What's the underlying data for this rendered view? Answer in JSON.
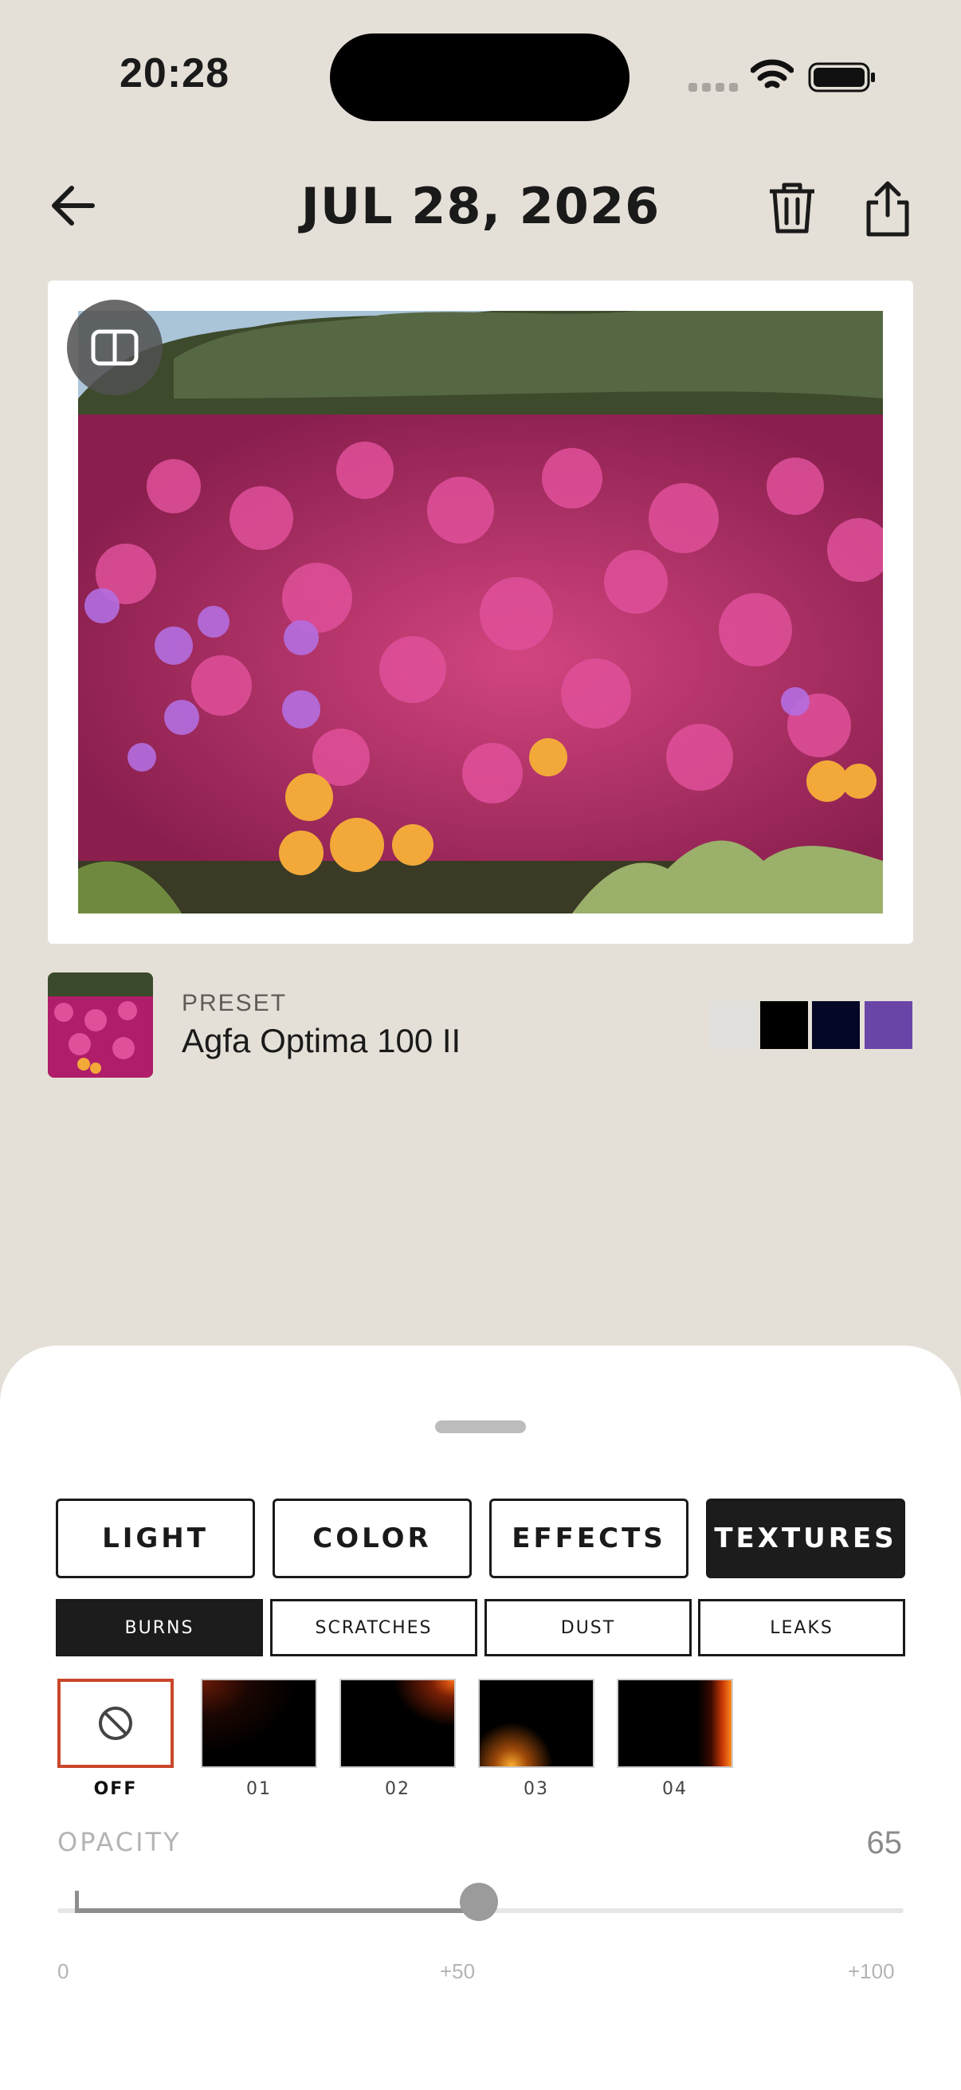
{
  "status_bar": {
    "time": "20:28"
  },
  "header": {
    "title": "JUL 28, 2026"
  },
  "preset": {
    "label": "PRESET",
    "name": "Agfa Optima 100 II",
    "swatches": [
      "#e2e0dd",
      "#000000",
      "#050726",
      "#6a45a8"
    ]
  },
  "tabs": [
    {
      "label": "LIGHT",
      "active": false
    },
    {
      "label": "COLOR",
      "active": false
    },
    {
      "label": "EFFECTS",
      "active": false
    },
    {
      "label": "TEXTURES",
      "active": true
    }
  ],
  "subtabs": [
    {
      "label": "BURNS",
      "active": true
    },
    {
      "label": "SCRATCHES",
      "active": false
    },
    {
      "label": "DUST",
      "active": false
    },
    {
      "label": "LEAKS",
      "active": false
    }
  ],
  "textures": [
    {
      "label": "OFF",
      "selected": true
    },
    {
      "label": "01",
      "selected": false
    },
    {
      "label": "02",
      "selected": false
    },
    {
      "label": "03",
      "selected": false
    },
    {
      "label": "04",
      "selected": false
    }
  ],
  "opacity": {
    "label": "OPACITY",
    "value": "65",
    "level": 0.65,
    "ticks": [
      "0",
      "+50",
      "+100"
    ]
  },
  "colors": {
    "accent_selected": "#c9472a",
    "active_tab": "#1c1c1c",
    "background": "#e5e0d7"
  }
}
